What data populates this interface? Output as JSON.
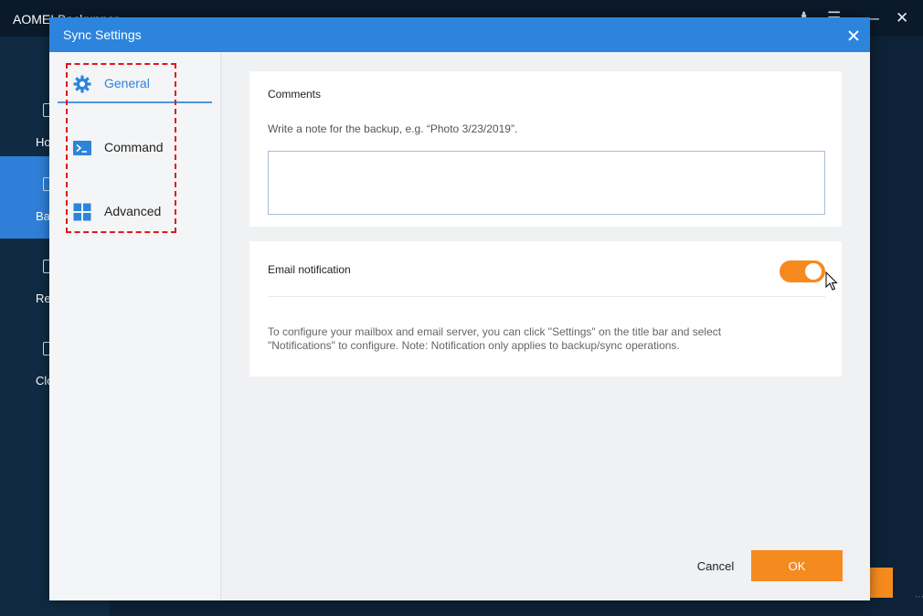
{
  "background_app": {
    "title": "AOMEI Backupper",
    "nav": [
      {
        "label": "Home"
      },
      {
        "label": "Backup"
      },
      {
        "label": "Restore"
      },
      {
        "label": "Clone"
      }
    ],
    "accent": "#2f7fd8"
  },
  "dialog": {
    "title": "Sync Settings",
    "nav": {
      "general": "General",
      "command": "Command",
      "advanced": "Advanced"
    },
    "comments": {
      "heading": "Comments",
      "hint": "Write a note for the backup, e.g. “Photo 3/23/2019”.",
      "value": ""
    },
    "email": {
      "label": "Email notification",
      "enabled": true,
      "description": "To configure your mailbox and email server, you can click \"Settings\" on the title bar and select \"Notifications\" to configure. Note: Notification only applies to backup/sync operations."
    },
    "buttons": {
      "cancel": "Cancel",
      "ok": "OK"
    }
  },
  "colors": {
    "title_bar": "#2c84dc",
    "ok_button": "#f58a1f",
    "toggle_on": "#f58a1f",
    "highlight": "#e4161c"
  }
}
